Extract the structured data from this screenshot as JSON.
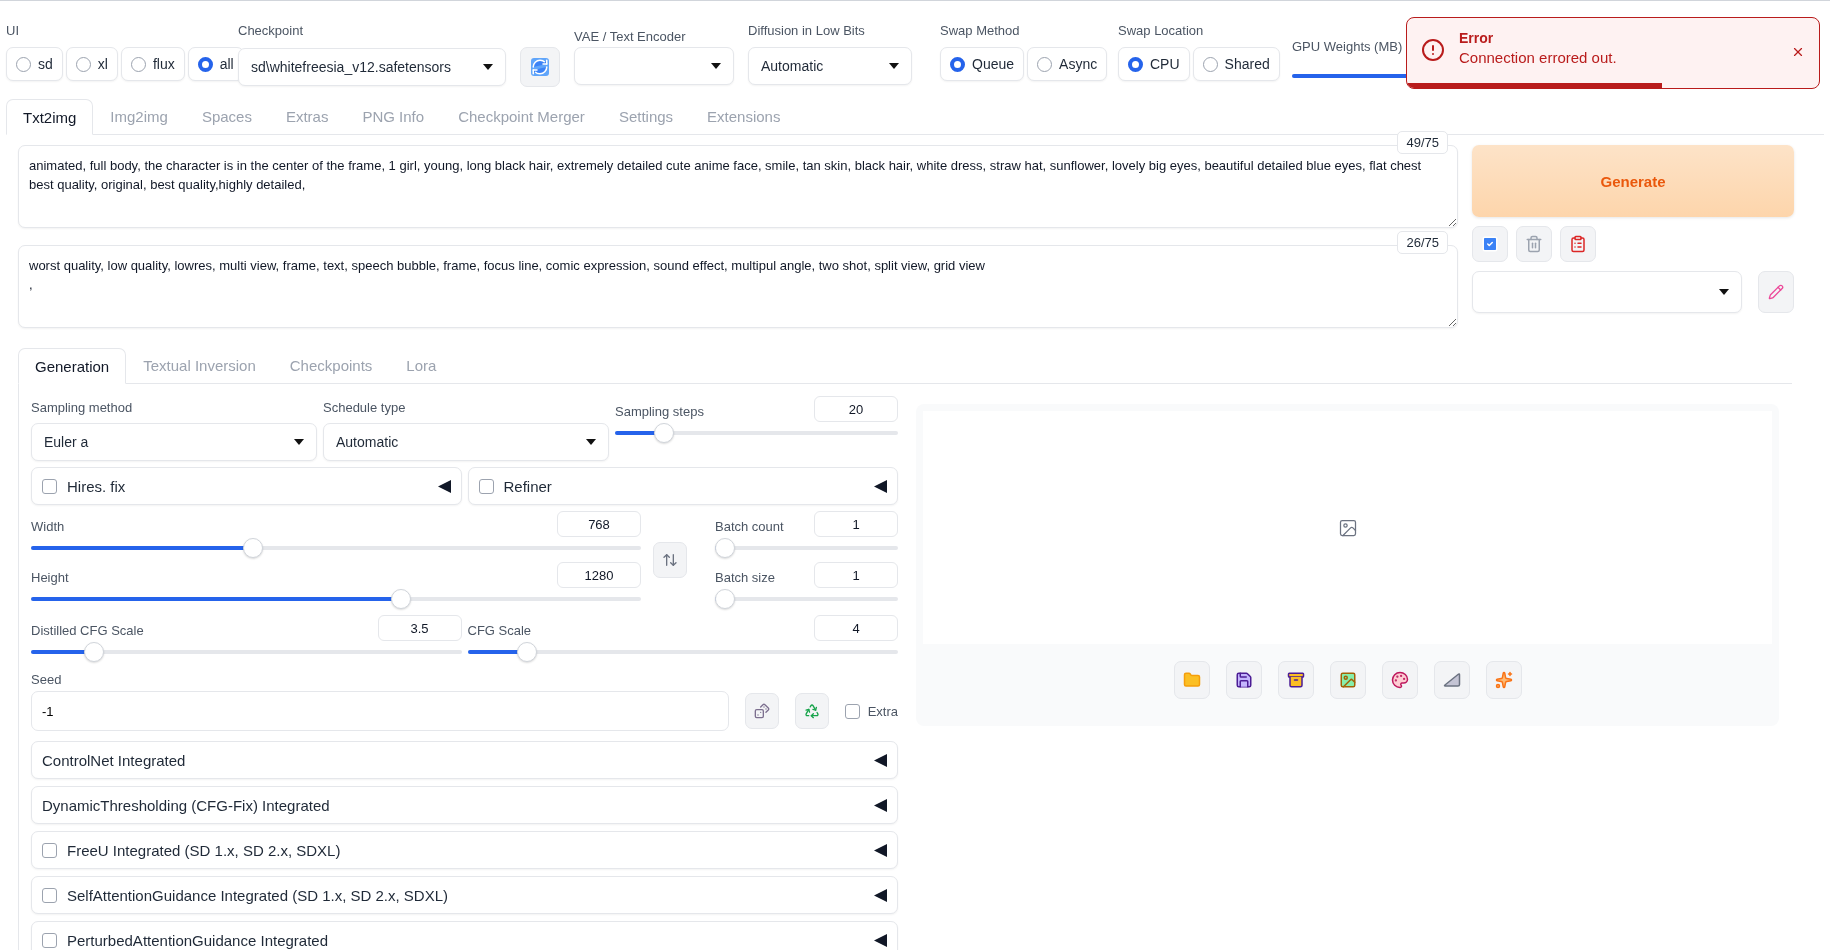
{
  "top_bar": {
    "ui": {
      "label": "UI",
      "options": [
        {
          "label": "sd",
          "selected": false
        },
        {
          "label": "xl",
          "selected": false
        },
        {
          "label": "flux",
          "selected": false
        },
        {
          "label": "all",
          "selected": true
        }
      ]
    },
    "checkpoint": {
      "label": "Checkpoint",
      "value": "sd\\whitefreesia_v12.safetensors"
    },
    "vae": {
      "label": "VAE / Text Encoder"
    },
    "diffusion": {
      "label": "Diffusion in Low Bits",
      "value": "Automatic"
    },
    "swap_method": {
      "label": "Swap Method",
      "options": [
        {
          "label": "Queue",
          "selected": true
        },
        {
          "label": "Async",
          "selected": false
        }
      ]
    },
    "swap_location": {
      "label": "Swap Location",
      "options": [
        {
          "label": "CPU",
          "selected": true
        },
        {
          "label": "Shared",
          "selected": false
        }
      ]
    },
    "gpu_weights": {
      "label": "GPU Weights (MB)",
      "level": 0.9
    }
  },
  "toast": {
    "title": "Error",
    "message": "Connection errored out.",
    "level": 0.62
  },
  "tabs": [
    {
      "label": "Txt2img",
      "selected": true
    },
    {
      "label": "Img2img",
      "selected": false
    },
    {
      "label": "Spaces",
      "selected": false
    },
    {
      "label": "Extras",
      "selected": false
    },
    {
      "label": "PNG Info",
      "selected": false
    },
    {
      "label": "Checkpoint Merger",
      "selected": false
    },
    {
      "label": "Settings",
      "selected": false
    },
    {
      "label": "Extensions",
      "selected": false
    }
  ],
  "prompt": {
    "text": "animated, full body, the character is in the center of the frame, 1 girl, young, long black hair, extremely detailed cute anime face, smile, tan skin, black hair, white dress, straw hat, sunflower, lovely big eyes, beautiful detailed blue eyes, flat chest best quality, original, best quality,highly detailed,",
    "counter": "49/75"
  },
  "negative_prompt": {
    "text": "worst quality, low quality, lowres, multi view, frame, text, speech bubble, frame, focus line, comic expression, sound effect, multipul angle, two shot, split view, grid view\n,",
    "counter": "26/75"
  },
  "generate": {
    "label": "Generate"
  },
  "generation_tabs": [
    {
      "label": "Generation",
      "selected": true
    },
    {
      "label": "Textual Inversion",
      "selected": false
    },
    {
      "label": "Checkpoints",
      "selected": false
    },
    {
      "label": "Lora",
      "selected": false
    }
  ],
  "sampling_method": {
    "label": "Sampling method",
    "value": "Euler a"
  },
  "schedule_type": {
    "label": "Schedule type",
    "value": "Automatic"
  },
  "sampling_steps": {
    "label": "Sampling steps",
    "value": "20",
    "level": 0.15
  },
  "hires_fix": {
    "label": "Hires. fix",
    "checked": false
  },
  "refiner": {
    "label": "Refiner",
    "checked": false
  },
  "width": {
    "label": "Width",
    "value": "768",
    "level": 0.36
  },
  "height": {
    "label": "Height",
    "value": "1280",
    "level": 0.61
  },
  "batch_count": {
    "label": "Batch count",
    "value": "1",
    "level": 0
  },
  "batch_size": {
    "label": "Batch size",
    "value": "1",
    "level": 0
  },
  "distilled_cfg": {
    "label": "Distilled CFG Scale",
    "value": "3.5",
    "level": 0.13
  },
  "cfg": {
    "label": "CFG Scale",
    "value": "4",
    "level": 0.12
  },
  "seed": {
    "label": "Seed",
    "value": "-1"
  },
  "extra": {
    "label": "Extra",
    "checked": false
  },
  "accordions": [
    {
      "kind": "plain",
      "label": "ControlNet Integrated"
    },
    {
      "kind": "plain",
      "label": "DynamicThresholding (CFG-Fix) Integrated"
    },
    {
      "kind": "checkbox",
      "label": "FreeU Integrated (SD 1.x, SD 2.x, SDXL)",
      "checked": false
    },
    {
      "kind": "checkbox",
      "label": "SelfAttentionGuidance Integrated (SD 1.x, SD 2.x, SDXL)",
      "checked": false
    },
    {
      "kind": "checkbox",
      "label": "PerturbedAttentionGuidance Integrated",
      "checked": false
    }
  ]
}
